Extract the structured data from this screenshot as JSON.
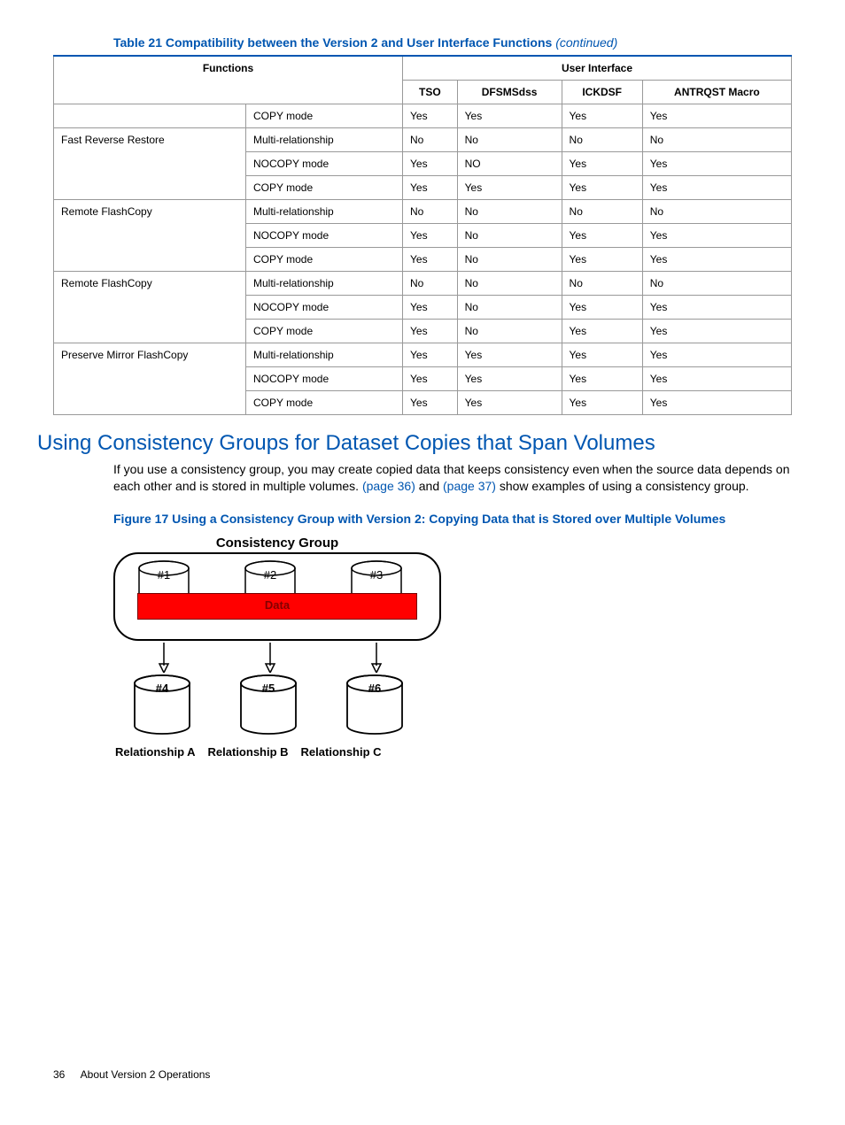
{
  "table_caption": {
    "prefix": "Table 21 Compatibility between the Version 2 and User Interface Functions",
    "suffix": "(continued)"
  },
  "table": {
    "header": {
      "functions": "Functions",
      "user_interface": "User Interface",
      "cols": [
        "TSO",
        "DFSMSdss",
        "ICKDSF",
        "ANTRQST Macro"
      ]
    },
    "groups": [
      {
        "func": "",
        "rows": [
          {
            "mode": "COPY mode",
            "vals": [
              "Yes",
              "Yes",
              "Yes",
              "Yes"
            ]
          }
        ]
      },
      {
        "func": "Fast Reverse Restore",
        "rows": [
          {
            "mode": "Multi-relationship",
            "vals": [
              "No",
              "No",
              "No",
              "No"
            ]
          },
          {
            "mode": "NOCOPY mode",
            "vals": [
              "Yes",
              "NO",
              "Yes",
              "Yes"
            ]
          },
          {
            "mode": "COPY mode",
            "vals": [
              "Yes",
              "Yes",
              "Yes",
              "Yes"
            ]
          }
        ]
      },
      {
        "func": "Remote FlashCopy",
        "rows": [
          {
            "mode": "Multi-relationship",
            "vals": [
              "No",
              "No",
              "No",
              "No"
            ]
          },
          {
            "mode": "NOCOPY mode",
            "vals": [
              "Yes",
              "No",
              "Yes",
              "Yes"
            ]
          },
          {
            "mode": "COPY mode",
            "vals": [
              "Yes",
              "No",
              "Yes",
              "Yes"
            ]
          }
        ]
      },
      {
        "func": "Remote FlashCopy",
        "rows": [
          {
            "mode": "Multi-relationship",
            "vals": [
              "No",
              "No",
              "No",
              "No"
            ]
          },
          {
            "mode": "NOCOPY mode",
            "vals": [
              "Yes",
              "No",
              "Yes",
              "Yes"
            ]
          },
          {
            "mode": "COPY mode",
            "vals": [
              "Yes",
              "No",
              "Yes",
              "Yes"
            ]
          }
        ]
      },
      {
        "func": "Preserve Mirror FlashCopy",
        "rows": [
          {
            "mode": "Multi-relationship",
            "vals": [
              "Yes",
              "Yes",
              "Yes",
              "Yes"
            ]
          },
          {
            "mode": "NOCOPY mode",
            "vals": [
              "Yes",
              "Yes",
              "Yes",
              "Yes"
            ]
          },
          {
            "mode": "COPY mode",
            "vals": [
              "Yes",
              "Yes",
              "Yes",
              "Yes"
            ]
          }
        ]
      }
    ]
  },
  "section_heading": "Using Consistency Groups for Dataset Copies that Span Volumes",
  "paragraph": {
    "part1": "If you use a consistency group, you may create copied data that keeps consistency even when the source data depends on each other and is stored in multiple volumes. ",
    "link1": "(page 36)",
    "mid": " and ",
    "link2": "(page 37)",
    "part2": " show examples of using a consistency group."
  },
  "figure_caption": "Figure 17 Using a Consistency Group with Version 2: Copying Data that is Stored over Multiple Volumes",
  "diagram": {
    "title": "Consistency Group",
    "sources": [
      "#1",
      "#2",
      "#3"
    ],
    "data_label": "Data",
    "targets": [
      "#4",
      "#5",
      "#6"
    ],
    "relationships": [
      "Relationship A",
      "Relationship B",
      "Relationship C"
    ]
  },
  "footer": {
    "page": "36",
    "text": "About Version 2 Operations"
  }
}
